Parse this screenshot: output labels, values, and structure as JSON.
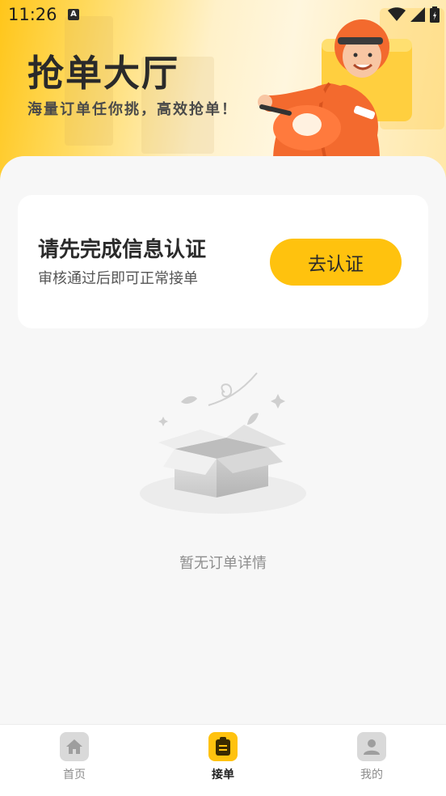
{
  "status_bar": {
    "time": "11:26",
    "notification_badge": "A"
  },
  "hero": {
    "title": "抢单大厅",
    "subtitle": "海量订单任你挑，高效抢单！"
  },
  "verify_card": {
    "title": "请先完成信息认证",
    "description": "审核通过后即可正常接单",
    "button_label": "去认证"
  },
  "empty_state": {
    "text": "暂无订单详情",
    "icon": "empty-box-icon"
  },
  "tabbar": {
    "items": [
      {
        "label": "首页",
        "icon": "home-icon",
        "active": false
      },
      {
        "label": "接单",
        "icon": "clipboard-icon",
        "active": true
      },
      {
        "label": "我的",
        "icon": "user-icon",
        "active": false
      }
    ]
  },
  "colors": {
    "accent": "#ffc20e",
    "text_primary": "#2a2a2a",
    "background": "#f7f7f7"
  }
}
